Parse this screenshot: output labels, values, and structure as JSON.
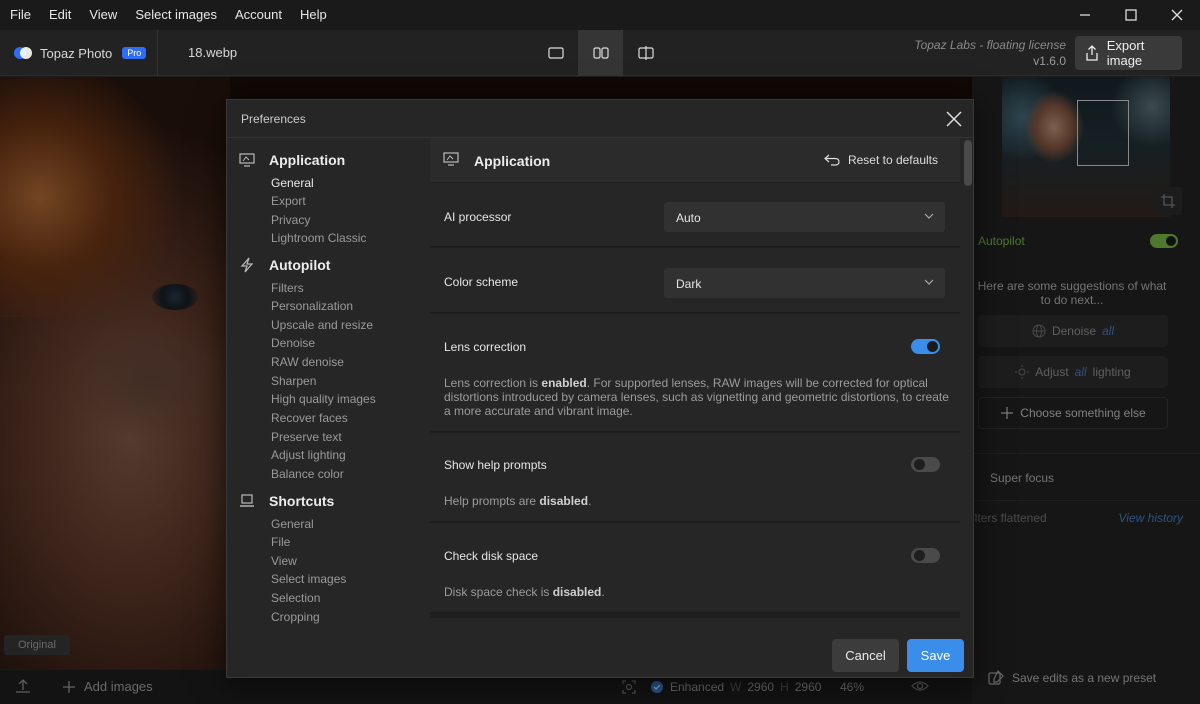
{
  "menu": [
    "File",
    "Edit",
    "View",
    "Select images",
    "Account",
    "Help"
  ],
  "app": {
    "name": "Topaz Photo",
    "badge": "Pro",
    "filename": "18.webp"
  },
  "license": {
    "text": "Topaz Labs - floating license",
    "version": "v1.6.0"
  },
  "toolbar": {
    "export_label": "Export image"
  },
  "canvas": {
    "original_label": "Original"
  },
  "right_panel": {
    "autopilot_label": "Autopilot",
    "suggestion_text": "Here are some suggestions of what to do next...",
    "cards": [
      {
        "pre": "Denoise",
        "em": "all",
        "post": ""
      },
      {
        "pre": "Adjust",
        "em": "all",
        "post": "lighting"
      }
    ],
    "choose_label": "Choose something else",
    "super_focus_label": "Super focus",
    "history_text": "ilters flattened",
    "view_history_label": "View history",
    "save_preset_label": "Save edits as a new preset"
  },
  "bottom": {
    "add_images_label": "Add images",
    "enhanced_label": "Enhanced",
    "w_label": "W",
    "w_value": "2960",
    "h_label": "H",
    "h_value": "2960",
    "zoom": "46%"
  },
  "preferences": {
    "title": "Preferences",
    "nav": [
      {
        "label": "Application",
        "icon": "monitor-icon",
        "items": [
          "General",
          "Export",
          "Privacy",
          "Lightroom Classic"
        ]
      },
      {
        "label": "Autopilot",
        "icon": "lightning-icon",
        "items": [
          "Filters",
          "Personalization",
          "Upscale and resize",
          "Denoise",
          "RAW denoise",
          "Sharpen",
          "High quality images",
          "Recover faces",
          "Preserve text",
          "Adjust lighting",
          "Balance color"
        ]
      },
      {
        "label": "Shortcuts",
        "icon": "laptop-icon",
        "items": [
          "General",
          "File",
          "View",
          "Select images",
          "Selection",
          "Cropping"
        ]
      }
    ],
    "content_title": "Application",
    "reset_label": "Reset to defaults",
    "ai_processor": {
      "label": "AI processor",
      "value": "Auto"
    },
    "color_scheme": {
      "label": "Color scheme",
      "value": "Dark"
    },
    "lens_correction": {
      "label": "Lens correction",
      "enabled": true,
      "desc_pre": "Lens correction is ",
      "desc_state": "enabled",
      "desc_post": ". For supported lenses, RAW images will be corrected for optical distortions introduced by camera lenses, such as vignetting and geometric distortions, to create a more accurate and vibrant image."
    },
    "help_prompts": {
      "label": "Show help prompts",
      "enabled": false,
      "desc_pre": "Help prompts are ",
      "desc_state": "disabled",
      "desc_post": "."
    },
    "disk_space": {
      "label": "Check disk space",
      "enabled": false,
      "desc_pre": "Disk space check is ",
      "desc_state": "disabled",
      "desc_post": "."
    },
    "cancel_label": "Cancel",
    "save_label": "Save"
  },
  "colors": {
    "accent": "#3a8de8",
    "autopilot": "#7fc248",
    "brand": "#2f6df6"
  }
}
